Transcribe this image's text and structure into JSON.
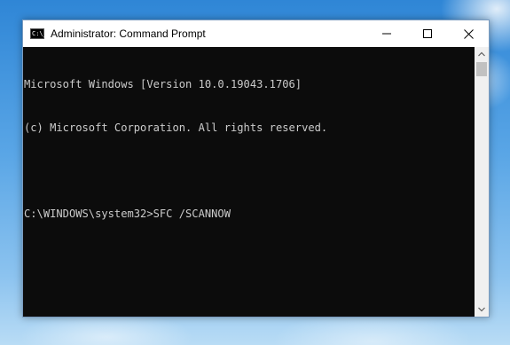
{
  "window": {
    "title": "Administrator: Command Prompt",
    "icon_label": "C:\\_"
  },
  "controls": {
    "minimize": "minimize-icon",
    "maximize": "maximize-icon",
    "close": "close-icon"
  },
  "console": {
    "lines": [
      "Microsoft Windows [Version 10.0.19043.1706]",
      "(c) Microsoft Corporation. All rights reserved.",
      "",
      "C:\\WINDOWS\\system32>SFC /SCANNOW"
    ]
  },
  "colors": {
    "console_bg": "#0c0c0c",
    "console_text": "#cccccc",
    "titlebar_bg": "#ffffff"
  }
}
